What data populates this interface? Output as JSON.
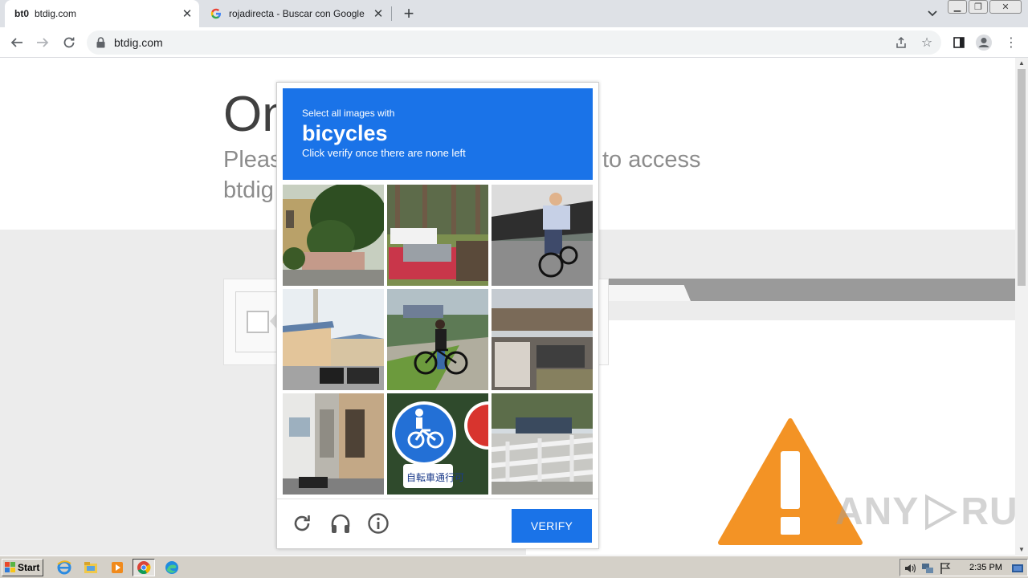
{
  "browser": {
    "tabs": [
      {
        "favicon": "bt0",
        "title": "btdig.com",
        "active": true
      },
      {
        "favicon": "google-g-icon",
        "title": "rojadirecta - Buscar con Google",
        "active": false
      }
    ],
    "address": "btdig.com"
  },
  "page": {
    "heading": "On",
    "subtext_line1": "Pleas",
    "subtext_line1_end": "to access",
    "subtext_line2": "btdig"
  },
  "captcha": {
    "instruction_small": "Select all images with",
    "instruction_target": "bicycles",
    "instruction_hint": "Click verify once there are none left",
    "verify_label": "VERIFY",
    "tiles": [
      "house-trees",
      "trucks-trees",
      "man-on-bicycle",
      "houses-pole",
      "woman-with-bicycle",
      "shed-building",
      "narrow-alley",
      "bicycle-sign",
      "railing-car"
    ]
  },
  "watermark": {
    "left": "ANY",
    "right": "RUN"
  },
  "taskbar": {
    "start_label": "Start",
    "clock": "2:35 PM"
  },
  "colors": {
    "accent": "#1a73e8",
    "warning": "#f39325"
  }
}
